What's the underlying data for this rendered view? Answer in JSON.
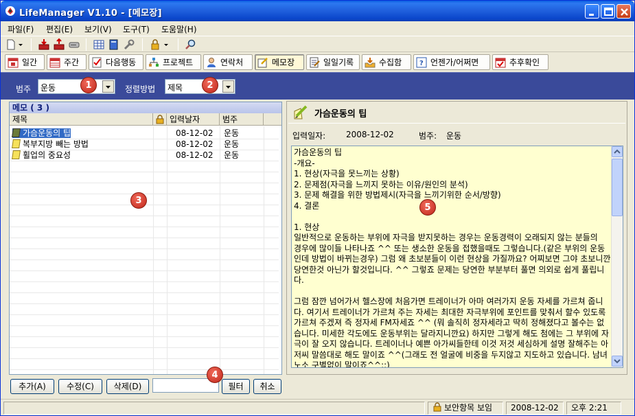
{
  "window": {
    "title": "LifeManager V1.10 - [메모장]"
  },
  "menu": [
    "파일(F)",
    "편집(E)",
    "보기(V)",
    "도구(T)",
    "도움말(H)"
  ],
  "modules": [
    {
      "label": "일간",
      "icon": "calendar-day-icon"
    },
    {
      "label": "주간",
      "icon": "calendar-week-icon"
    },
    {
      "label": "다음행동",
      "icon": "checklist-icon"
    },
    {
      "label": "프로젝트",
      "icon": "project-icon"
    },
    {
      "label": "연락처",
      "icon": "contact-icon"
    },
    {
      "label": "메모장",
      "icon": "memo-icon"
    },
    {
      "label": "일일기록",
      "icon": "journal-icon"
    },
    {
      "label": "수집함",
      "icon": "inbox-icon"
    },
    {
      "label": "언젠가/어쩌면",
      "icon": "someday-icon"
    },
    {
      "label": "추후확인",
      "icon": "followup-icon"
    }
  ],
  "filter": {
    "category_label": "범주",
    "category_value": "운동",
    "sort_label": "정렬방법",
    "sort_value": "제목"
  },
  "badges": [
    "1",
    "2",
    "3",
    "4",
    "5"
  ],
  "memo_list": {
    "header": "메모 ( 3 )",
    "columns": [
      "제목",
      "입력날자",
      "범주"
    ],
    "rows": [
      {
        "title": "가슴운동의 팁",
        "date": "08-12-02",
        "category": "운동",
        "selected": true
      },
      {
        "title": "복부지방 빼는 방법",
        "date": "08-12-02",
        "category": "운동",
        "selected": false
      },
      {
        "title": "휠업의 중요성",
        "date": "08-12-02",
        "category": "운동",
        "selected": false
      }
    ]
  },
  "buttons": {
    "add": "추가(A)",
    "edit": "수정(C)",
    "delete": "삭제(D)",
    "filter": "필터",
    "cancel": "취소"
  },
  "filter_input": {
    "value": ""
  },
  "detail": {
    "title": "가슴운동의 팁",
    "date_label": "입력일자:",
    "date_value": "2008-12-02",
    "category_label": "범주:",
    "category_value": "운동",
    "body": "가슴운동의 팁\n-개요-\n1. 현상(자극을 못느끼는 상황)\n2. 문제점(자극을 느끼지 못하는 이유/원인의 분석)\n3. 문제 해결을 위한 방법제시(자극을 느끼기위한 순서/방향)\n4. 결론\n\n1. 현상\n일반적으로 운동하는 부위에 자극을 받지못하는 경우는 운동경력이 오래되지 않는 분들의\n경우에 많이들 나타나죠 ^^ 또는 생소한 운동을 접했을때도 그렇습니다.(같은 부위의 운동인데 방법이 바뀌는경우) 그럼 왜 초보분들이 이런 현상을 가질까요? 어찌보면 그야 초보니깐 당연한것 아닌가 할것입니다. ^^ 그렇죠 문제는 당연한 부분부터 풀면 의외로 쉽게 풀립니다.\n\n그럼 잠깐 넘어가서 헬스장에 처음가면 트레이너가 아마 여러가지 운동 자세를 가르쳐 줍니다. 여기서 트레이너가 가르쳐 주는 자세는 최대한 자극부위에 포인트를 맞춰서 할수 있도록 가르쳐 주겠져 즉 정자세 FM자세죠 ^^ (뭐 솔직히 정자세라고 딱히 정해졌다고 볼수는 없습니다. 미세한 각도에도 운동부위는 달라지니깐요) 하지만 그렇게 해도 첨에는 그 부위에 자극이 잘 오지 않습니다. 트레이너나 예쁜 아가씨들한테 이것 저것 세심하게 설명 잘해주는 아저씨 말씀대로 해도 말이죠 ^^(그래도 전 얼굴에 비중을 두지않고 지도하고 있습니다. 남녀노소 구별없이 말이죠^^;;)"
  },
  "status": {
    "secure": "보안항목 보임",
    "date": "2008-12-02",
    "time": "오후 2:21"
  }
}
